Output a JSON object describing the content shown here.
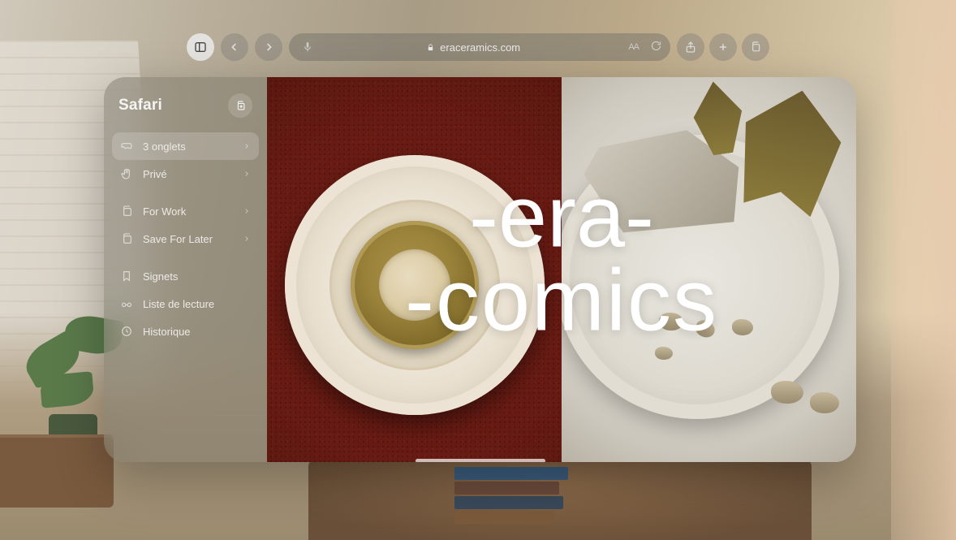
{
  "toolbar": {
    "url": "eraceramics.com",
    "aa_label": "AA"
  },
  "sidebar": {
    "title": "Safari",
    "items": [
      {
        "label": "3 onglets",
        "icon": "goggles",
        "chevron": true,
        "selected": true
      },
      {
        "label": "Privé",
        "icon": "hand",
        "chevron": true,
        "selected": false
      },
      {
        "label": "For Work",
        "icon": "tabs",
        "chevron": true,
        "selected": false
      },
      {
        "label": "Save For Later",
        "icon": "tabs",
        "chevron": true,
        "selected": false
      },
      {
        "label": "Signets",
        "icon": "bookmark",
        "chevron": false,
        "selected": false
      },
      {
        "label": "Liste de lecture",
        "icon": "glasses",
        "chevron": false,
        "selected": false
      },
      {
        "label": "Historique",
        "icon": "clock",
        "chevron": false,
        "selected": false
      }
    ]
  },
  "page": {
    "logo_line1": "-era-",
    "logo_line2": "-comics"
  }
}
